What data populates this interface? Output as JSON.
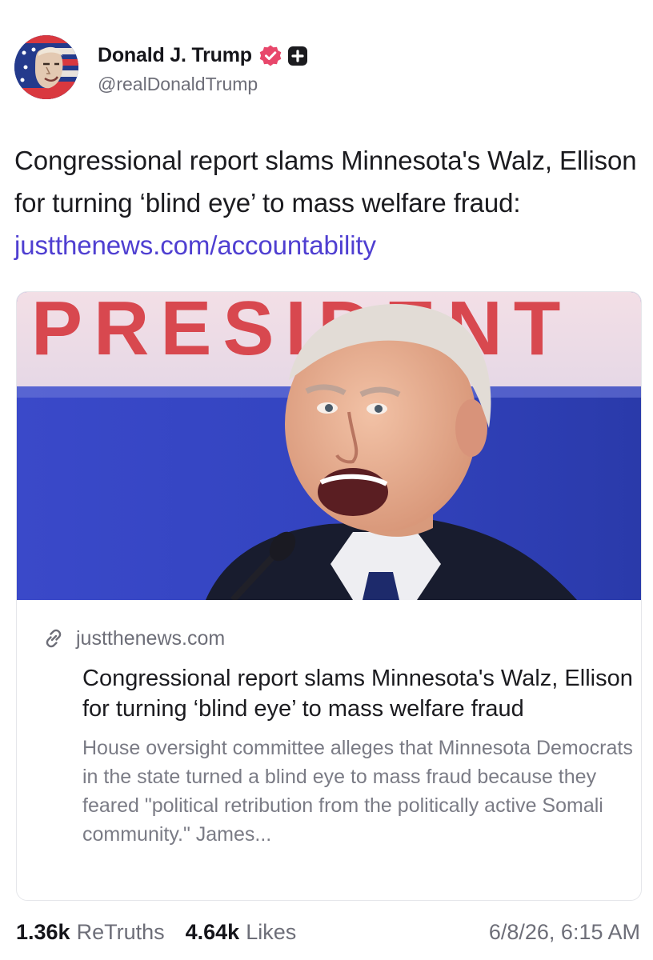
{
  "author": {
    "display_name": "Donald J. Trump",
    "handle": "@realDonaldTrump",
    "avatar_icon": "user-avatar",
    "verified_icon": "verified-badge-icon",
    "verified_color": "#e8476b",
    "plus_icon": "plus-badge-icon"
  },
  "post": {
    "text": "Congressional report slams Minnesota's Walz, Ellison for turning ‘blind eye’ to mass welfare fraud: ",
    "link_text": "justthenews.com/accountability",
    "link_color": "#4f3fd1"
  },
  "card": {
    "image_alt": "photo",
    "banner_text": "PRESIDENT",
    "link_icon": "link-icon",
    "domain": "justthenews.com",
    "title": "Congressional report slams Minnesota's Walz, Ellison for turning ‘blind eye’ to mass welfare fraud",
    "description": "House oversight committee alleges that Minnesota Democrats in the state turned a blind eye to mass fraud because they feared \"political retribution from the politically active Somali community.\" James..."
  },
  "stats": {
    "retruths_count": "1.36k",
    "retruths_label": "ReTruths",
    "likes_count": "4.64k",
    "likes_label": "Likes",
    "timestamp": "6/8/26, 6:15 AM"
  }
}
